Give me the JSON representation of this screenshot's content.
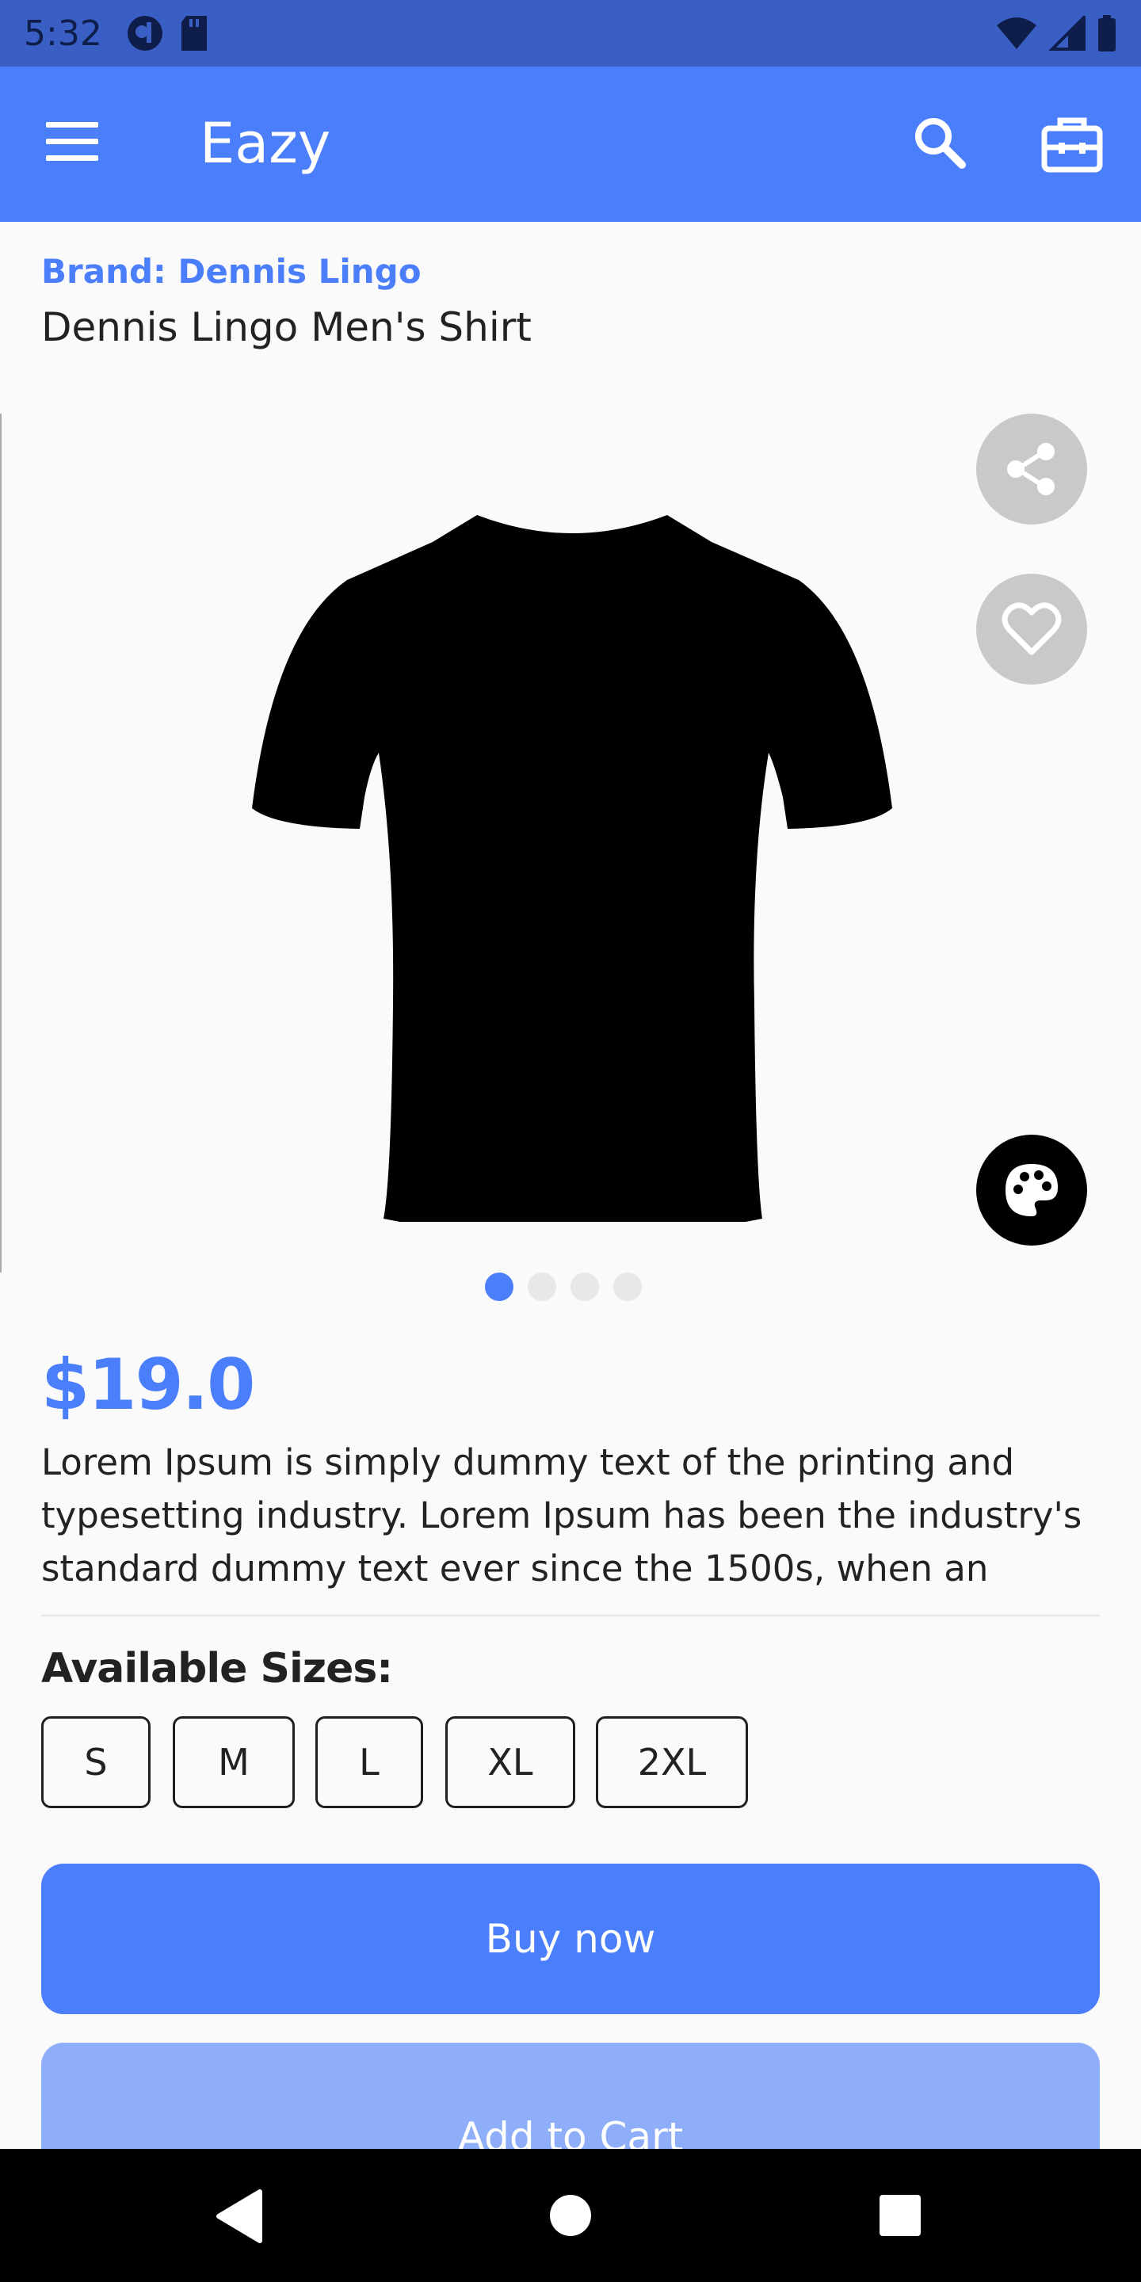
{
  "status_bar": {
    "time": "5:32"
  },
  "app_bar": {
    "title": "Eazy"
  },
  "product": {
    "brand": "Brand: Dennis Lingo",
    "name": "Dennis Lingo Men's Shirt",
    "price": "$19.0",
    "description": "Lorem Ipsum is simply dummy text of the printing and typesetting industry. Lorem Ipsum has been the industry's standard dummy text ever since the 1500s, when an",
    "image_pages": 4,
    "active_image": 1
  },
  "sizes": {
    "heading": "Available Sizes:",
    "options": [
      "S",
      "M",
      "L",
      "XL",
      "2XL"
    ]
  },
  "actions": {
    "buy_now": "Buy now",
    "add_to_cart": "Add to Cart"
  },
  "colors": {
    "accent": "#4a7efb",
    "status_bar": "#3a5fc4",
    "add_to_cart_bg": "#8eaefa"
  }
}
